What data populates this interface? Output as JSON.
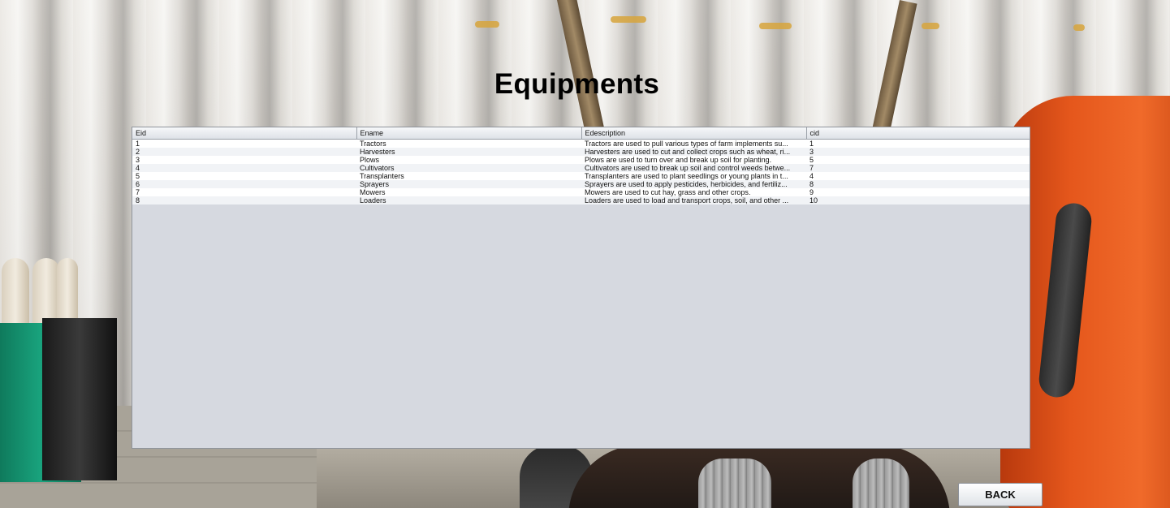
{
  "page": {
    "title": "Equipments",
    "back_label": "BACK"
  },
  "table": {
    "columns": [
      "Eid",
      "Ename",
      "Edescription",
      "cid"
    ],
    "rows": [
      [
        "1",
        "Tractors",
        "Tractors are used to pull various types of farm implements su...",
        "1"
      ],
      [
        "2",
        "Harvesters",
        " Harvesters are used to cut and collect crops such as wheat, ri...",
        "3"
      ],
      [
        "3",
        "Plows",
        "Plows are used to turn over and break up soil for planting.",
        "5"
      ],
      [
        "4",
        "Cultivators",
        "Cultivators are used to break up soil and control weeds betwe...",
        "7"
      ],
      [
        "5",
        "Transplanters",
        " Transplanters are used to plant seedlings or young plants in t...",
        "4"
      ],
      [
        "6",
        "Sprayers",
        " Sprayers are used to apply pesticides, herbicides, and fertiliz...",
        "8"
      ],
      [
        "7",
        "Mowers",
        " Mowers are used to cut hay, grass and other crops.",
        "9"
      ],
      [
        "8",
        "Loaders",
        "Loaders are used to load and transport crops, soil, and other ...",
        "10"
      ]
    ]
  },
  "colors": {
    "panel_background": "#d6d9e0",
    "row_alt": "#f1f3f6",
    "barrel_orange": "#e5571c"
  }
}
